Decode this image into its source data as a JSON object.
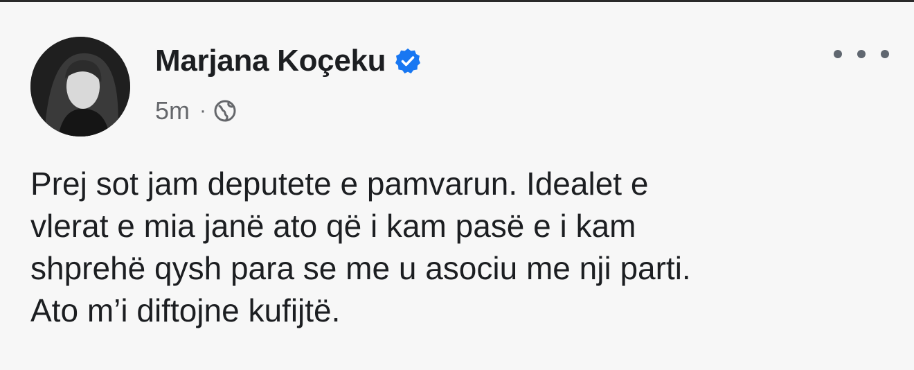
{
  "post": {
    "author_name": "Marjana Koçeku",
    "verified_icon": "verified-badge-icon",
    "timestamp": "5m",
    "separator": "·",
    "audience_icon": "globe-icon",
    "more_icon": "more-options-icon",
    "text_lines": [
      "Prej sot jam deputete e pamvarun. Idealet e",
      "vlerat e mia janë ato që i kam pasë e i kam",
      "shprehë qysh para se me u asociu me nji parti.",
      "Ato m’i diftojne kufijtë."
    ]
  },
  "colors": {
    "verified_blue": "#1877f2",
    "meta_gray": "#65676b",
    "text": "#1c1e21"
  }
}
